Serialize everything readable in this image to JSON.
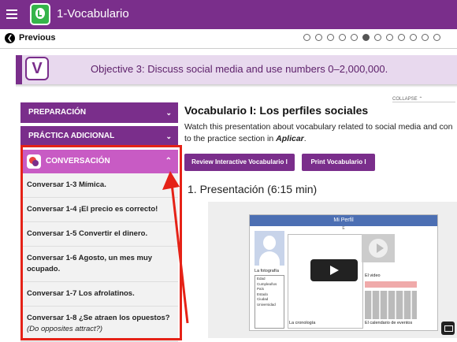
{
  "app": {
    "title": "1-Vocabulario",
    "menu_icon": "hamburger-icon",
    "logo_icon": "speech-bubble-logo-icon"
  },
  "nav": {
    "previous_label": "Previous",
    "pager_total": 12,
    "pager_active_index": 5
  },
  "objective": {
    "badge": "V",
    "text": "Objective 3: Discuss social media and use numbers 0–2,000,000."
  },
  "sidebar": {
    "sections": [
      {
        "label": "PREPARACIÓN",
        "expanded": false
      },
      {
        "label": "PRÁCTICA ADICIONAL",
        "expanded": false
      }
    ],
    "conversation": {
      "label": "CONVERSACIÓN",
      "icon": "chat-bubbles-icon",
      "items": [
        {
          "label": "Conversar 1-3 Mímica."
        },
        {
          "label": "Conversar 1-4 ¡El precio es correcto!"
        },
        {
          "label": "Conversar 1-5 Convertir el dinero."
        },
        {
          "label": "Conversar 1-6 Agosto, un mes muy ocupado."
        },
        {
          "label": "Conversar 1-7 Los afrolatinos."
        },
        {
          "label": "Conversar 1-8 ¿Se atraen los opuestos?",
          "sub": "(Do opposites attract?)"
        }
      ]
    }
  },
  "main": {
    "collapse_label": "COLLAPSE ⌃",
    "title": "Vocabulario I: Los perfiles sociales",
    "description_line1": "Watch this presentation about vocabulary related to social media and con",
    "description_line2_prefix": "to the practice section in ",
    "description_line2_emph": "Aplicar",
    "description_line2_suffix": ".",
    "buttons": {
      "review": "Review Interactive Vocabulario I",
      "print": "Print Vocabulario I"
    },
    "presentation_heading": "1. Presentación (6:15 min)"
  },
  "video": {
    "card_title": "Mi Perfil",
    "card_sub": "E",
    "photo_label": "La fotografía",
    "fields": [
      "Edad",
      "Cumpleaños",
      "País",
      "Estado",
      "Ciudad",
      "Universidad"
    ],
    "timeline_label": "La cronología",
    "video_label": "El video",
    "calendar_label": "El calendario de eventos"
  },
  "colors": {
    "brand_purple": "#7a2e8b",
    "conversation_pink": "#c85bc4",
    "highlight_red": "#e52217",
    "logo_green": "#35b44a"
  }
}
